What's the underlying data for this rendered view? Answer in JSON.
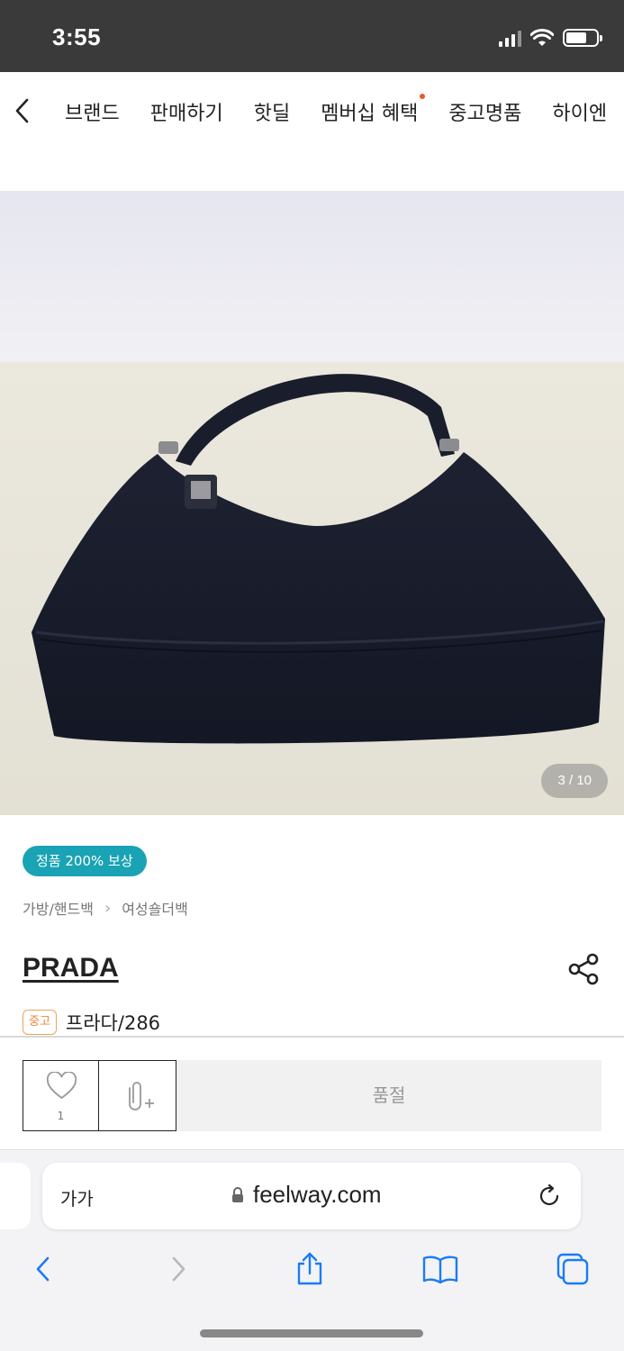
{
  "status_bar": {
    "time": "3:55"
  },
  "top_nav": {
    "items": [
      {
        "label": "브랜드"
      },
      {
        "label": "판매하기"
      },
      {
        "label": "핫딜"
      },
      {
        "label": "멤버십 혜택"
      },
      {
        "label": "중고명품"
      },
      {
        "label": "하이엔"
      }
    ]
  },
  "gallery": {
    "counter": "3 / 10"
  },
  "product": {
    "auth_badge": "정품 200% 보상",
    "breadcrumb": [
      "가방/핸드백",
      "여성숄더백"
    ],
    "brand": "PRADA",
    "condition": "중고",
    "model": "프라다/286",
    "likes": "1",
    "soldout_label": "품절"
  },
  "browser": {
    "text_size_label": "가가",
    "url": "feelway.com"
  },
  "colors": {
    "accent_teal": "#1aa3b4",
    "condition_orange": "#e8883a",
    "ios_blue": "#1a7cf5"
  }
}
